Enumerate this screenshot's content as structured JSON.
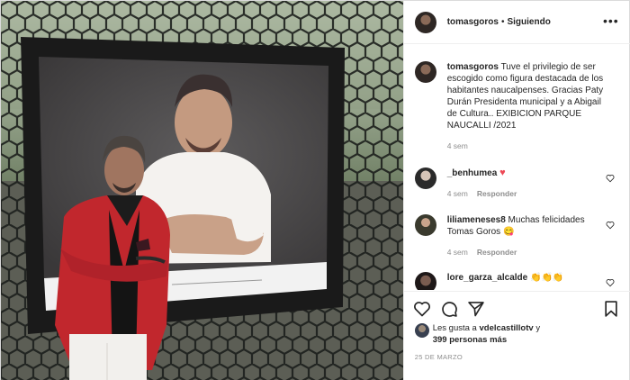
{
  "post": {
    "username": "tomasgoros",
    "follow_status": "Siguiendo",
    "separator": "•",
    "more_label": "•••"
  },
  "caption": {
    "username": "tomasgoros",
    "text": "Tuve el privilegio de ser escogido como figura destacada de los habitantes naucalpenses. Gracias Paty Durán Presidenta municipal y a Abigail de Cultura.. EXIBICION PARQUE NAUCALLI /2021",
    "time": "4 sem"
  },
  "comments": [
    {
      "username": "_benhumea",
      "text": "",
      "emoji": "♥",
      "time": "4 sem",
      "reply": "Responder"
    },
    {
      "username": "liliameneses8",
      "text": "Muchas felicidades Tomas Goros",
      "emoji": "😋",
      "time": "4 sem",
      "reply": "Responder"
    },
    {
      "username": "lore_garza_alcalde",
      "text": "",
      "emoji": "👏👏👏",
      "time": "",
      "reply": ""
    }
  ],
  "likes": {
    "prefix": "Les gusta a",
    "user": "vdelcastillotv",
    "conjunction": "y",
    "others": "399 personas más"
  },
  "date": "25 DE MARZO",
  "icons": [
    "heart-icon",
    "comment-icon",
    "share-icon",
    "bookmark-icon",
    "more-icon"
  ],
  "colors": {
    "red_heart": "#ed4956",
    "text": "#262626",
    "muted": "#8e8e8e",
    "border": "#efefef"
  }
}
